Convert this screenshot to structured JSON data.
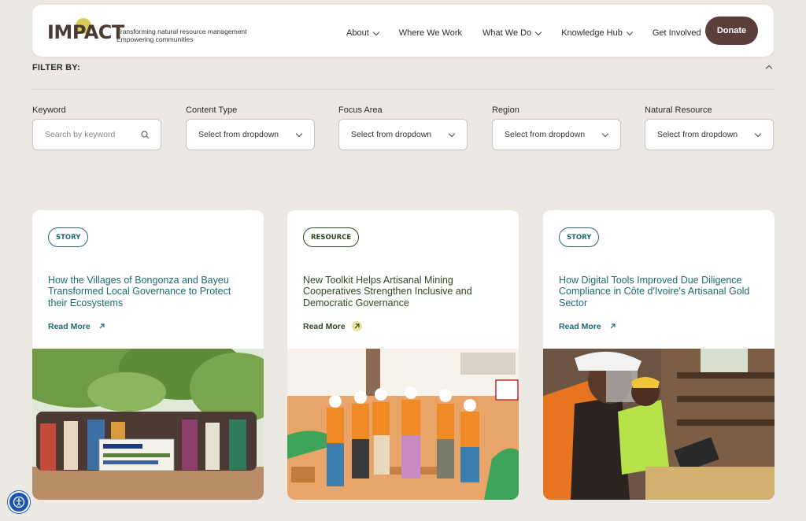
{
  "header": {
    "logo_text": "IMPACT",
    "tagline_1": "Transforming natural resource management",
    "tagline_2": "Empowering communities",
    "nav": [
      {
        "label": "About",
        "dropdown": true
      },
      {
        "label": "Where We Work",
        "dropdown": false
      },
      {
        "label": "What We Do",
        "dropdown": true
      },
      {
        "label": "Knowledge Hub",
        "dropdown": true
      },
      {
        "label": "Get Involved",
        "dropdown": true
      }
    ],
    "donate_label": "Donate"
  },
  "filter": {
    "title": "FILTER BY:",
    "fields": [
      {
        "label": "Keyword",
        "placeholder": "Search by keyword"
      },
      {
        "label": "Content Type",
        "value": "Select from dropdown"
      },
      {
        "label": "Focus Area",
        "value": "Select from dropdown"
      },
      {
        "label": "Region",
        "value": "Select from dropdown"
      },
      {
        "label": "Natural Resource",
        "value": "Select from dropdown"
      }
    ]
  },
  "cards": [
    {
      "badge": "STORY",
      "title": "How the Villages of Bongonza and Bayeu Transformed Local Governance to Protect their Ecosystems",
      "link": "Read More"
    },
    {
      "badge": "RESOURCE",
      "title": "New Toolkit Helps Artisanal Mining Cooperatives Strengthen Inclusive and Democratic Governance",
      "link": "Read More"
    },
    {
      "badge": "STORY",
      "title": "How Digital Tools Improved Due Diligence Compliance in Côte d'Ivoire's Artisanal Gold Sector",
      "link": "Read More"
    }
  ],
  "colors": {
    "background": "#ece9e5",
    "brand_dark": "#5b3d39",
    "teal": "#1e6a76",
    "green": "#2f4a20",
    "logo_accent": "#d8cb5a"
  },
  "icons": {
    "search": "search-icon",
    "chevron": "chevron-down-icon",
    "arrow": "arrow-up-right-icon",
    "accessibility": "accessibility-icon"
  }
}
